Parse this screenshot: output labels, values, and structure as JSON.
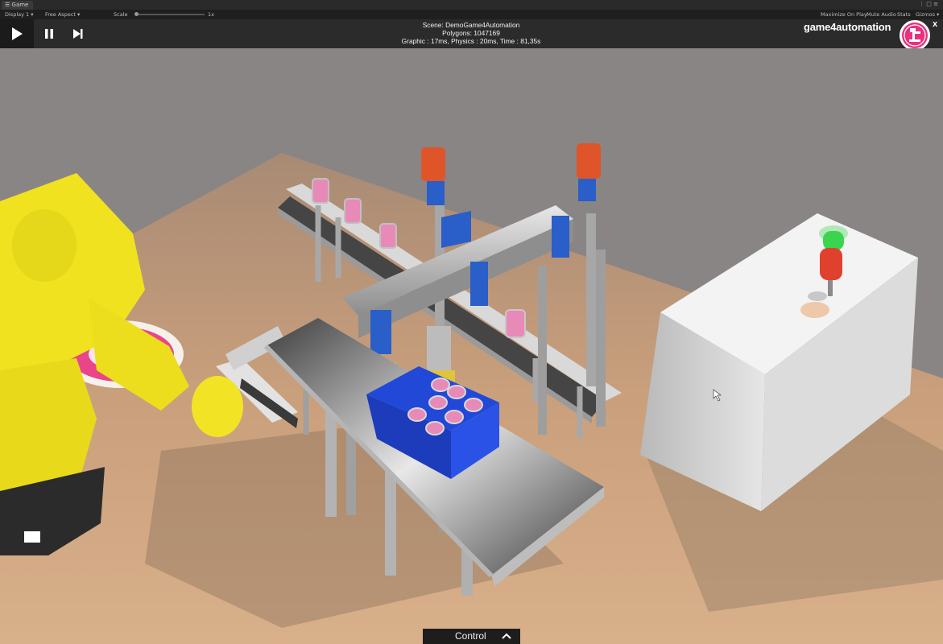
{
  "editor": {
    "tab_label": "Game",
    "display": "Display 1",
    "aspect": "Free Aspect",
    "scale_label": "Scale",
    "scale_value": "1x",
    "maximize": "Maximize On Play",
    "mute": "Mute Audio",
    "stats": "Stats",
    "gizmos": "Gizmos"
  },
  "hud": {
    "scene": "Scene: DemoGame4Automation",
    "polygons": "Polygons: 1047169",
    "timing": "Graphic : 17ms, Physics : 20ms, Time : 81,35s",
    "brand": "game4automation",
    "close": "x",
    "icons": [
      "play-icon",
      "pause-icon",
      "step-icon",
      "game4automation-logo",
      "close-icon"
    ]
  },
  "control": {
    "label": "Control",
    "icon": "chevron-up-icon"
  },
  "colors": {
    "hud_bg": "#2b2b2b",
    "ground": "#8a8585",
    "floor": "#c9a27e",
    "robot_yellow": "#f0e21e",
    "crate_blue": "#2248d8",
    "can_pink": "#e88ab8",
    "motor_orange": "#e0542a",
    "brand_pink": "#e8327d"
  }
}
